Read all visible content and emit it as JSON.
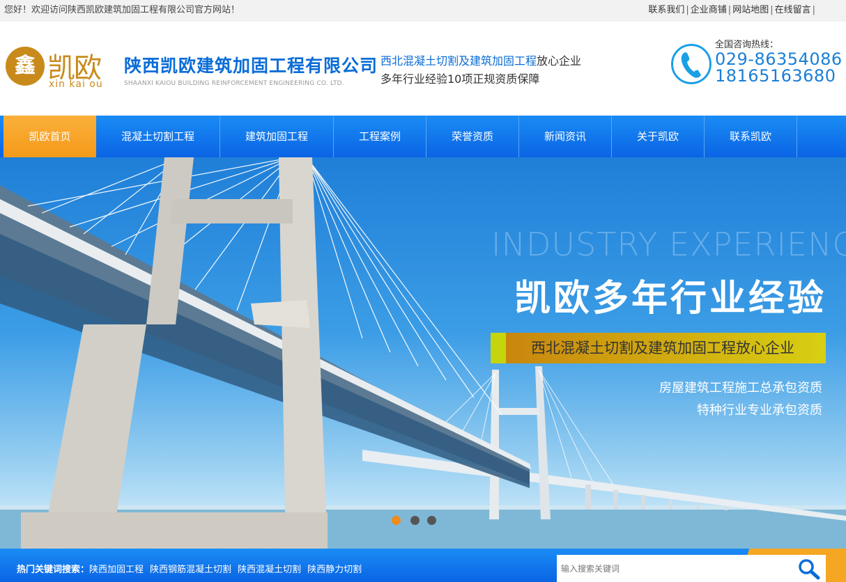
{
  "topbar": {
    "welcome": "您好！欢迎访问陕西凯欧建筑加固工程有限公司官方网站！",
    "links": [
      "联系我们",
      "企业商铺",
      "网站地图",
      "在线留言"
    ],
    "separator": "|"
  },
  "header": {
    "logo": {
      "mark": "鑫",
      "brand_cn": "凯欧",
      "brand_en": "xin kai ou"
    },
    "company_cn": "陕西凯欧建筑加固工程有限公司",
    "company_en": "SHAANXI KAIOU BUILDING REINFORCEMENT ENGINEERING CO. LTD.",
    "slogan_highlight": "西北混凝土切割及建筑加固工程",
    "slogan_rest": "放心企业",
    "slogan_line2": "多年行业经验10项正规资质保障",
    "hotline_label": "全国咨询热线：",
    "phone1": "029-86354086",
    "phone2": "18165163680"
  },
  "nav": {
    "items": [
      "凯欧首页",
      "混凝土切割工程",
      "建筑加固工程",
      "工程案例",
      "荣誉资质",
      "新闻资讯",
      "关于凯欧",
      "联系凯欧"
    ],
    "active_index": 0
  },
  "banner": {
    "en_title": "INDUSTRY EXPERIENCE",
    "cn_title": "凯欧多年行业经验",
    "subtitle": "西北混凝土切割及建筑加固工程放心企业",
    "line1": "房屋建筑工程施工总承包资质",
    "line2": "特种行业专业承包资质",
    "slides": 3,
    "active_slide": 0
  },
  "keywords": {
    "label": "热门关键词搜索：",
    "items": [
      "陕西加固工程",
      "陕西钢筋混凝土切割",
      "陕西混凝土切割",
      "陕西静力切割"
    ]
  },
  "search": {
    "placeholder": "输入搜索关键词"
  },
  "colors": {
    "primary_blue": "#0a6cd7",
    "accent_orange": "#f5a623",
    "gold": "#c98a1c"
  }
}
